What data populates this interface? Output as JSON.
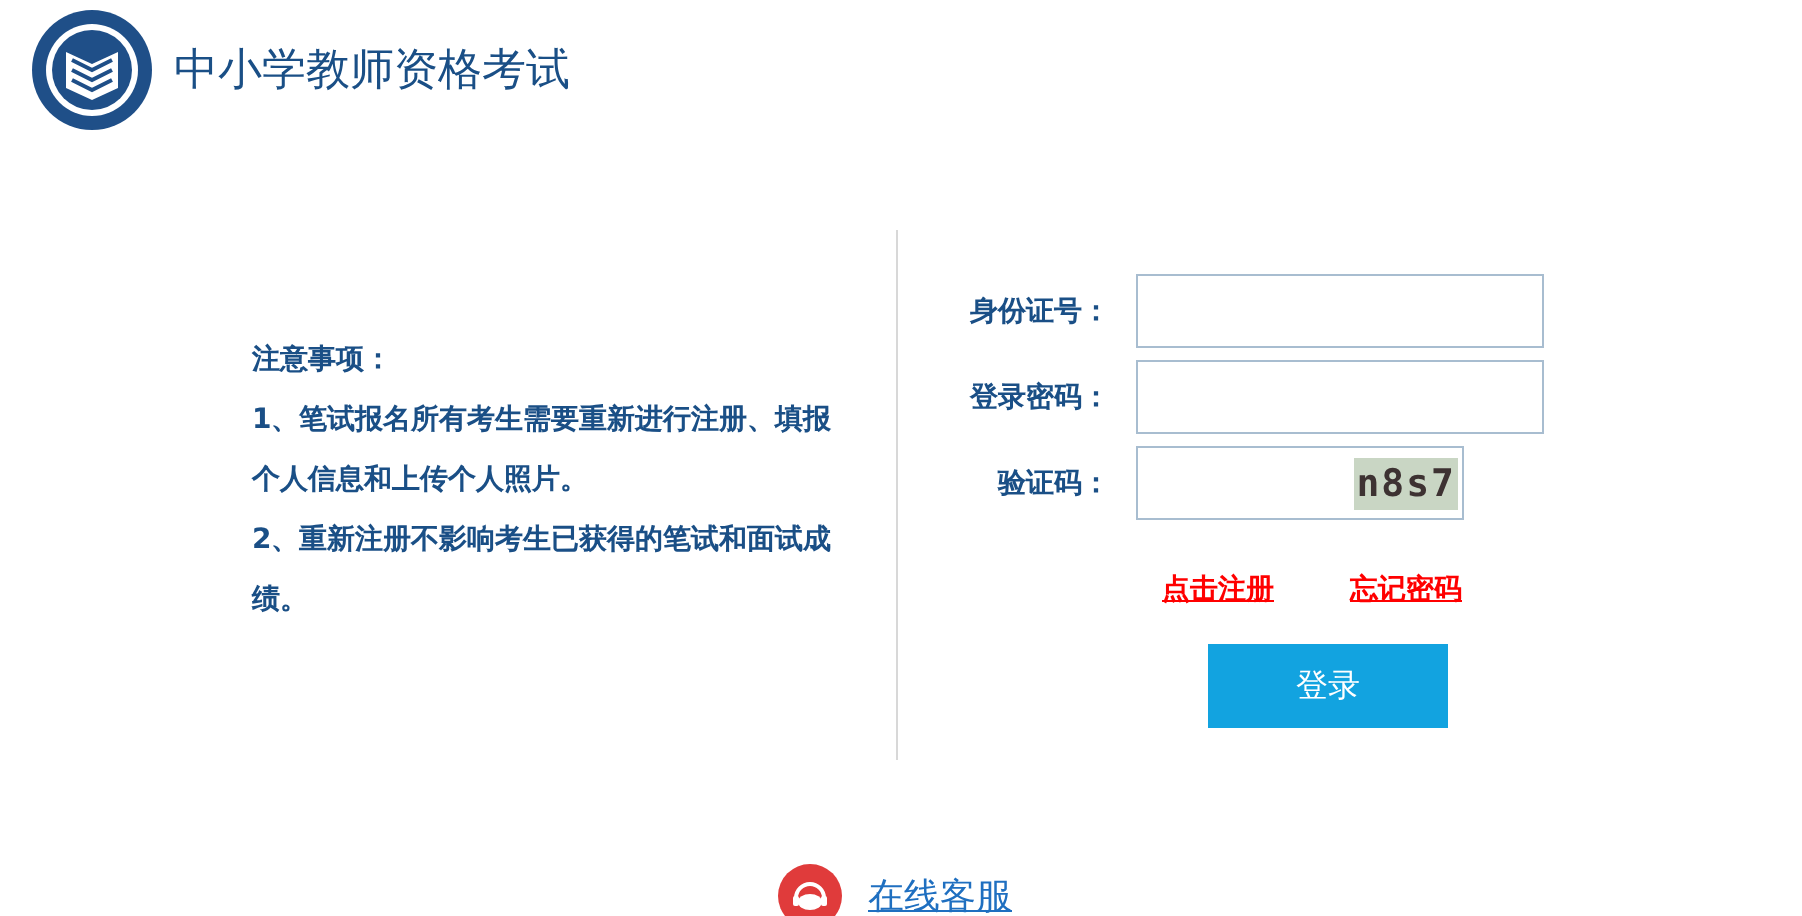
{
  "header": {
    "title": "中小学教师资格考试"
  },
  "notice": {
    "heading": "注意事项：",
    "items": [
      "1、笔试报名所有考生需要重新进行注册、填报个人信息和上传个人照片。",
      "2、重新注册不影响考生已获得的笔试和面试成绩。"
    ]
  },
  "form": {
    "fields": [
      {
        "label": "身份证号：",
        "kind": "text"
      },
      {
        "label": "登录密码：",
        "kind": "password"
      },
      {
        "label": "验证码：",
        "kind": "captcha",
        "captcha": "n8s7"
      }
    ],
    "links": [
      "点击注册",
      "忘记密码"
    ],
    "submit": "登录"
  },
  "footer": {
    "service_link": "在线客服"
  }
}
